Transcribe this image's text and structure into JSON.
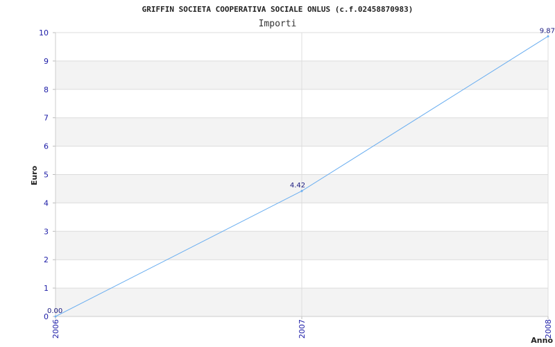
{
  "chart_data": {
    "type": "line",
    "title": "GRIFFIN SOCIETA COOPERATIVA SOCIALE ONLUS (c.f.02458870983)",
    "subtitle": "Importi",
    "xlabel": "Anno",
    "ylabel": "Euro",
    "categories": [
      "2006",
      "2007",
      "2008"
    ],
    "series": [
      {
        "values": [
          0.0,
          4.42,
          9.87
        ],
        "labels": [
          "0.00",
          "4.42",
          "9.87"
        ]
      }
    ],
    "ylim": [
      0,
      10
    ],
    "yticks": [
      "0",
      "1",
      "2",
      "3",
      "4",
      "5",
      "6",
      "7",
      "8",
      "9",
      "10"
    ],
    "grid": true,
    "band_colors": [
      "#ffffff",
      "#f3f3f3"
    ],
    "line_color": "#6aaef0",
    "tick_color": "#1a1aa6"
  }
}
